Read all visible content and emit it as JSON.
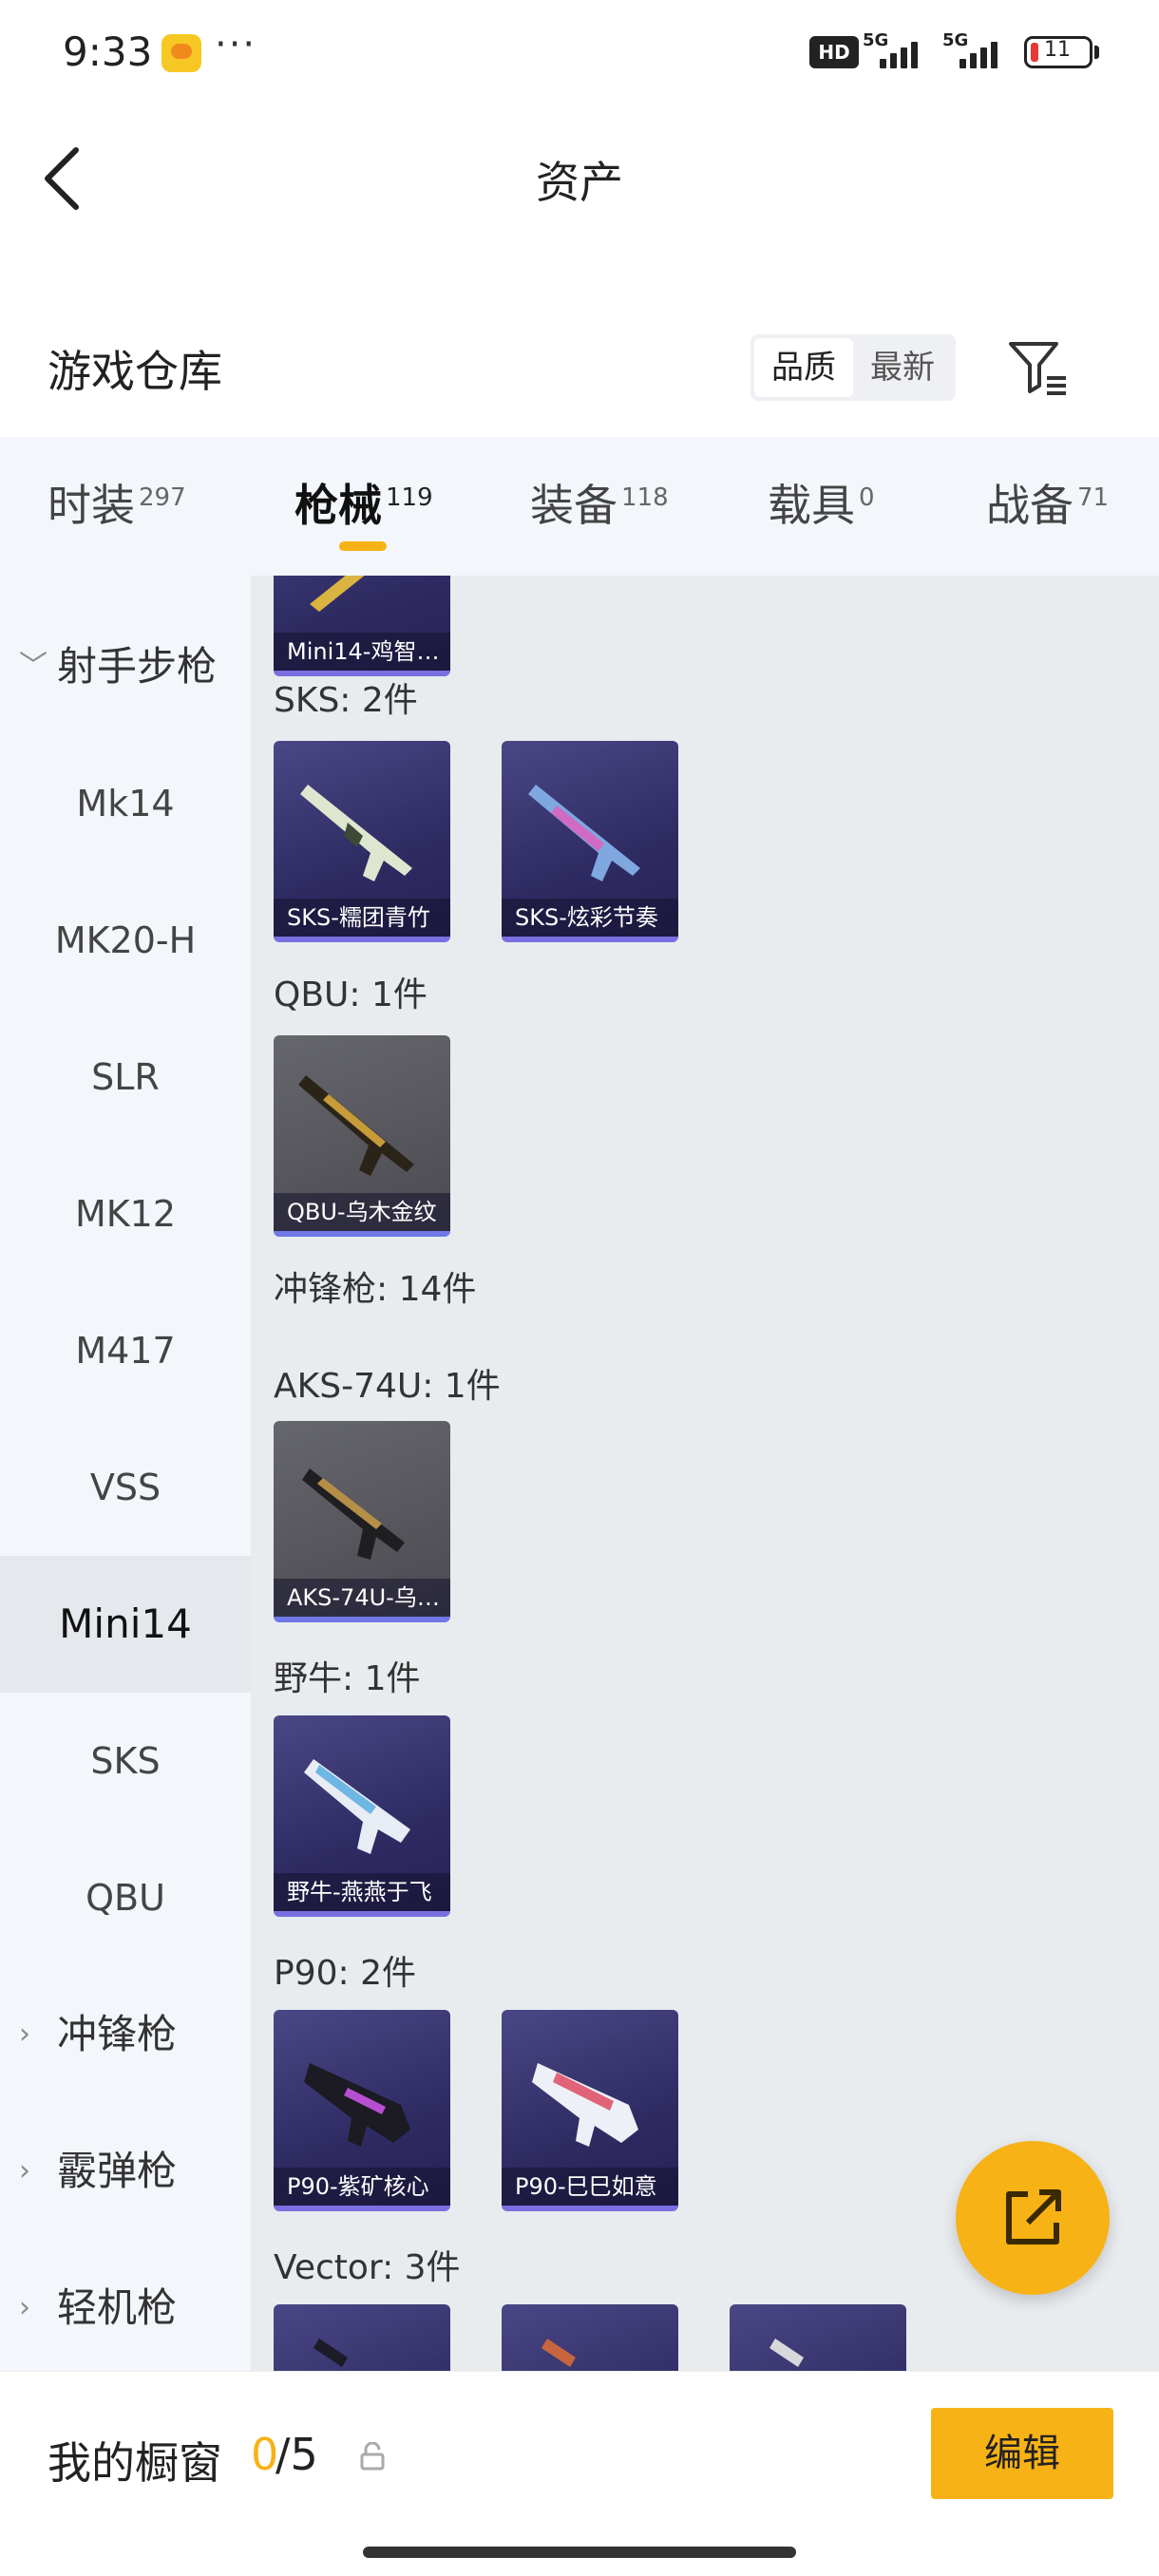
{
  "status_bar": {
    "time": "9:33",
    "dots": "···",
    "hd": "HD",
    "signal_1": "5G",
    "signal_2": "5G",
    "battery": "11"
  },
  "header": {
    "title": "资产",
    "back_icon": "chevron-left-icon"
  },
  "warehouse": {
    "title": "游戏仓库",
    "sort_options": [
      "品质",
      "最新"
    ],
    "sort_selected": "品质",
    "filter_icon": "filter-icon"
  },
  "tabs": [
    {
      "label": "时装",
      "count": "297"
    },
    {
      "label": "枪械",
      "count": "119",
      "active": true
    },
    {
      "label": "装备",
      "count": "118"
    },
    {
      "label": "载具",
      "count": "0"
    },
    {
      "label": "战备",
      "count": "71"
    }
  ],
  "sidebar": {
    "groups": [
      {
        "label": "射手步枪",
        "chevron": "﹀"
      },
      {
        "label": "冲锋枪",
        "chevron": "›"
      },
      {
        "label": "霰弹枪",
        "chevron": "›"
      },
      {
        "label": "轻机枪",
        "chevron": "›"
      }
    ],
    "items": [
      "Mk14",
      "MK20-H",
      "SLR",
      "MK12",
      "M417",
      "VSS",
      "Mini14",
      "SKS",
      "QBU"
    ],
    "selected": "Mini14"
  },
  "content": {
    "top_partial_card": "Mini14-鸡智…",
    "groups": [
      {
        "header": "SKS: 2件",
        "items": [
          "SKS-糯团青竹",
          "SKS-炫彩节奏"
        ]
      },
      {
        "header": "QBU: 1件",
        "items": [
          "QBU-乌木金纹"
        ]
      },
      {
        "header": "冲锋枪: 14件"
      },
      {
        "header": "AKS-74U: 1件",
        "items": [
          "AKS-74U-乌…"
        ]
      },
      {
        "header": "野牛: 1件",
        "items": [
          "野牛-燕燕于飞"
        ]
      },
      {
        "header": "P90: 2件",
        "items": [
          "P90-紫矿核心",
          "P90-巳巳如意"
        ]
      },
      {
        "header": "Vector: 3件"
      }
    ]
  },
  "fab": {
    "icon": "share-external-icon"
  },
  "bottom_bar": {
    "label": "我的橱窗",
    "count_current": "0",
    "count_rest": "/5",
    "lock_icon": "lock-icon",
    "edit_label": "编辑"
  },
  "colors": {
    "accent": "#f7b215",
    "tab_bg": "#f3f6fa",
    "content_bg": "#e9ecef",
    "card_purple": "#2f2b63",
    "card_grey": "#55555b"
  }
}
